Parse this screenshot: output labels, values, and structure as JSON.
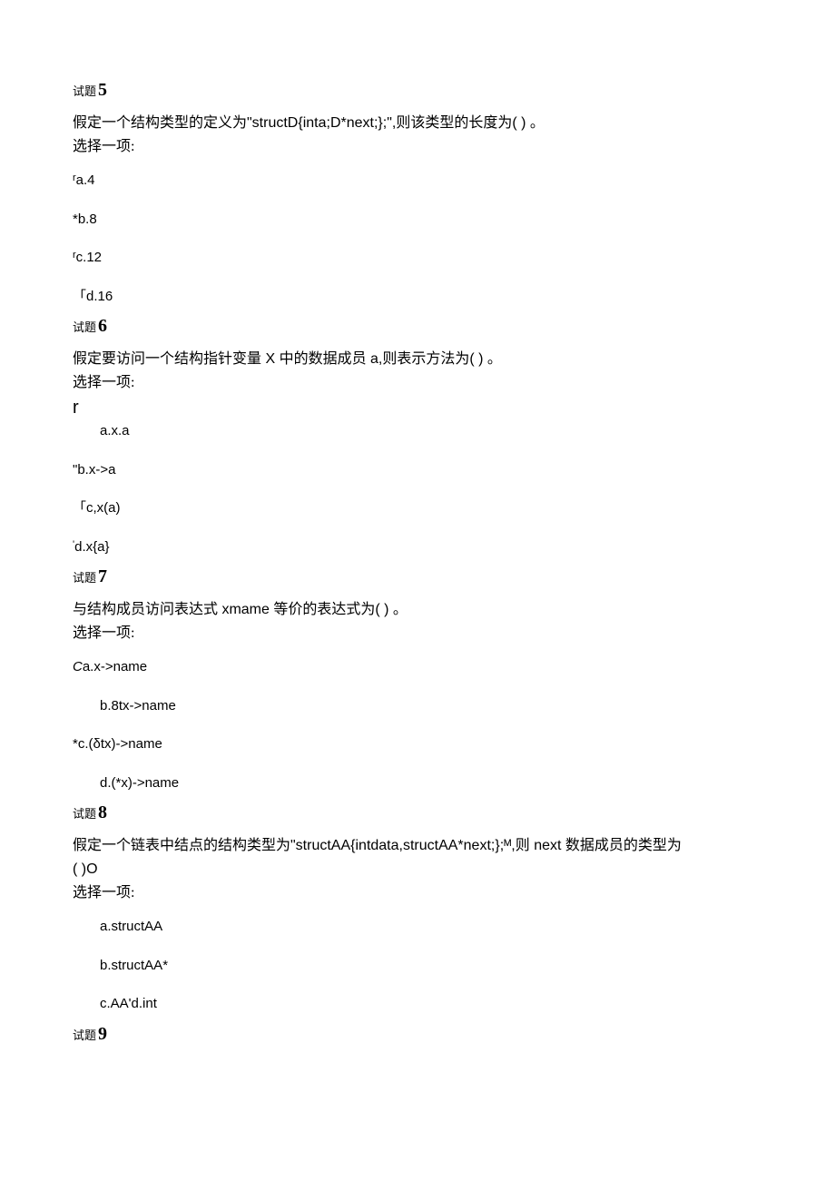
{
  "questions": [
    {
      "heading_small": "试题",
      "heading_big": "5",
      "text": "假定一个结构类型的定义为\"structD{inta;D*next;};\",则该类型的长度为( ) 。",
      "prompt": "选择一项:",
      "options": [
        {
          "prefix": "r",
          "label": "a.4",
          "indent": false
        },
        {
          "prefix": "*",
          "label": "b.8",
          "indent": false
        },
        {
          "prefix": "r",
          "label": "c.12",
          "indent": false
        },
        {
          "prefix": "「",
          "label": "d.16",
          "indent": false
        }
      ]
    },
    {
      "heading_small": "试题",
      "heading_big": "6",
      "text": "假定要访问一个结构指针变量 X 中的数据成员 a,则表示方法为( ) 。",
      "prompt": "选择一项:",
      "options_special": {
        "r_line": "r",
        "a_line": "a.x.a",
        "b": {
          "prefix": "\"",
          "label": "b.x->a"
        },
        "c": {
          "prefix": "「",
          "label": "c,x(a)"
        },
        "d": {
          "prefix": "'",
          "label": "d.x{a}"
        }
      }
    },
    {
      "heading_small": "试题",
      "heading_big": "7",
      "text": "与结构成员访问表达式 xmame 等价的表达式为( ) 。",
      "prompt": "选择一项:",
      "options": [
        {
          "prefix": "C",
          "label": "a.x->name",
          "indent": false,
          "italic_prefix": true
        },
        {
          "prefix": "",
          "label": "b.8tx->name",
          "indent": true
        },
        {
          "prefix": "*",
          "label": "c.(δtx)->name",
          "indent": false
        },
        {
          "prefix": "",
          "label": "d.(*x)->name",
          "indent": true
        }
      ]
    },
    {
      "heading_small": "试题",
      "heading_big": "8",
      "text_lines": [
        "假定一个链表中结点的结构类型为\"structAA{intdata,structAA*next;};ᴹ,则 next 数据成员的类型为",
        "( )O"
      ],
      "prompt": "选择一项:",
      "options": [
        {
          "prefix": "",
          "label": "a.structAA",
          "indent": true
        },
        {
          "prefix": "",
          "label": "b.structAA*",
          "indent": true
        },
        {
          "prefix": "",
          "label": "c.AA'd.int",
          "indent": true
        }
      ]
    },
    {
      "heading_small": "试题",
      "heading_big": "9"
    }
  ]
}
